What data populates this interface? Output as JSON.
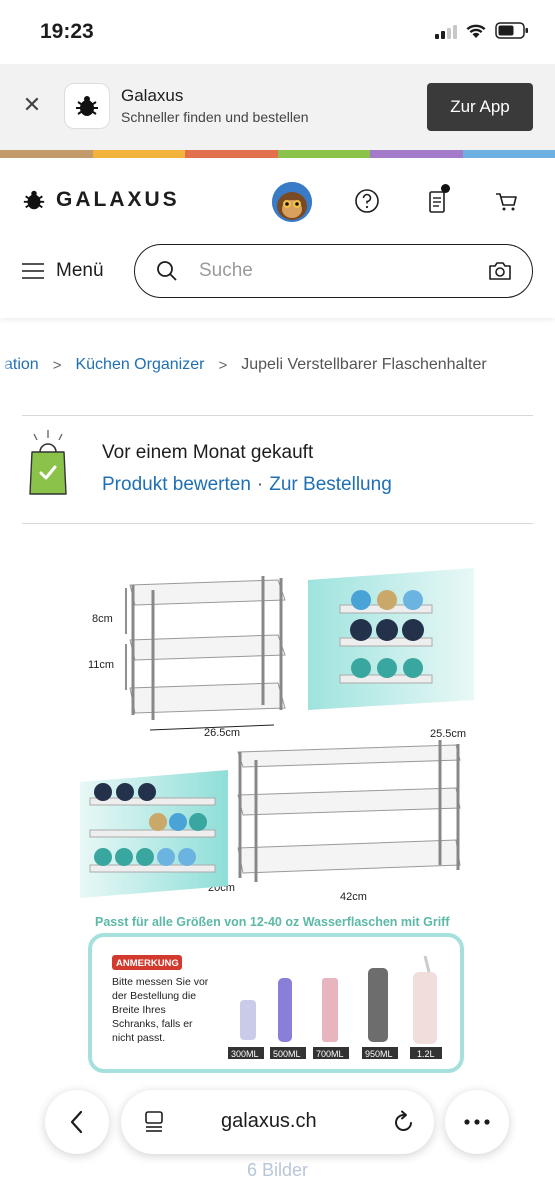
{
  "status_bar": {
    "time": "19:23"
  },
  "app_banner": {
    "title": "Galaxus",
    "subtitle": "Schneller finden und bestellen",
    "cta_label": "Zur App"
  },
  "brand_colors": [
    "#c39a6b",
    "#f2b33d",
    "#e2704f",
    "#8bc34a",
    "#a47acb",
    "#6fb0e3"
  ],
  "header": {
    "logo_text": "GALAXUS",
    "menu_label": "Menü",
    "search_placeholder": "Suche"
  },
  "breadcrumb": {
    "items": [
      "ation",
      "Küchen Organizer"
    ],
    "current": "Jupeli Verstellbarer Flaschenhalter"
  },
  "purchase": {
    "title": "Vor einem Monat gekauft",
    "link_rate": "Produkt bewerten",
    "separator": "·",
    "link_order": "Zur Bestellung"
  },
  "product_image": {
    "dimensions": {
      "height_top": "8cm",
      "height_bottom": "11cm",
      "width_small": "26.5cm",
      "depth_large": "25.5cm",
      "depth_left": "20cm",
      "width_large": "42cm"
    },
    "caption": "Passt für alle Größen von 12-40 oz Wasserflaschen mit Griff",
    "note_badge": "ANMERKUNG",
    "note_lines": [
      "Bitte messen Sie vor",
      "der Bestellung die",
      "Breite Ihres",
      "Schranks, falls er",
      "nicht passt."
    ],
    "bottle_sizes": [
      "300ML",
      "500ML",
      "700ML",
      "950ML",
      "1.2L"
    ]
  },
  "gallery": {
    "count_label": "6 Bilder"
  },
  "browser": {
    "url": "galaxus.ch"
  }
}
